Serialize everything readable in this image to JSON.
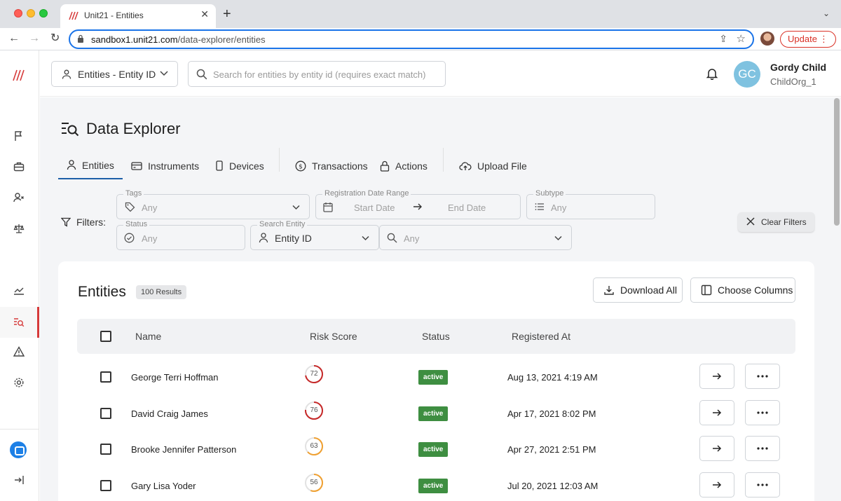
{
  "browser": {
    "tab_title": "Unit21 - Entities",
    "url_host": "sandbox1.unit21.com",
    "url_path": "/data-explorer/entities",
    "update_label": "Update"
  },
  "appbar": {
    "entity_select_label": "Entities - Entity ID",
    "search_placeholder": "Search for entities by entity id (requires exact match)",
    "user_initials": "GC",
    "user_name": "Gordy Child",
    "user_org": "ChildOrg_1"
  },
  "page": {
    "title": "Data Explorer",
    "tabs": [
      {
        "label": "Entities",
        "icon": "person-icon",
        "active": true
      },
      {
        "label": "Instruments",
        "icon": "card-icon"
      },
      {
        "label": "Devices",
        "icon": "device-icon"
      },
      {
        "label": "Transactions",
        "icon": "dollar-icon"
      },
      {
        "label": "Actions",
        "icon": "lock-icon"
      },
      {
        "label": "Upload File",
        "icon": "cloud-upload-icon"
      }
    ]
  },
  "filters": {
    "label": "Filters:",
    "tags_legend": "Tags",
    "tags_value": "Any",
    "date_legend": "Registration Date Range",
    "start_date": "Start Date",
    "end_date": "End Date",
    "subtype_legend": "Subtype",
    "subtype_value": "Any",
    "status_legend": "Status",
    "status_value": "Any",
    "search_entity_legend": "Search Entity",
    "search_entity_value": "Entity ID",
    "search_value": "Any",
    "clear_label": "Clear Filters"
  },
  "table": {
    "title": "Entities",
    "results": "100 Results",
    "download_label": "Download All",
    "columns_label": "Choose Columns",
    "headers": {
      "name": "Name",
      "risk": "Risk Score",
      "status": "Status",
      "registered": "Registered At"
    },
    "rows": [
      {
        "name": "George Terri Hoffman",
        "risk": "72",
        "status": "active",
        "registered": "Aug 13, 2021 4:19 AM"
      },
      {
        "name": "David Craig James",
        "risk": "76",
        "status": "active",
        "registered": "Apr 17, 2021 8:02 PM"
      },
      {
        "name": "Brooke Jennifer Patterson",
        "risk": "63",
        "status": "active",
        "registered": "Apr 27, 2021 2:51 PM"
      },
      {
        "name": "Gary Lisa Yoder",
        "risk": "56",
        "status": "active",
        "registered": "Jul 20, 2021 12:03 AM"
      }
    ]
  },
  "colors": {
    "accent": "#1d5fa8",
    "brand_red": "#d63a3a",
    "status_active": "#3e8e41",
    "risk_high": "#c62828",
    "risk_medium": "#f0a030"
  }
}
